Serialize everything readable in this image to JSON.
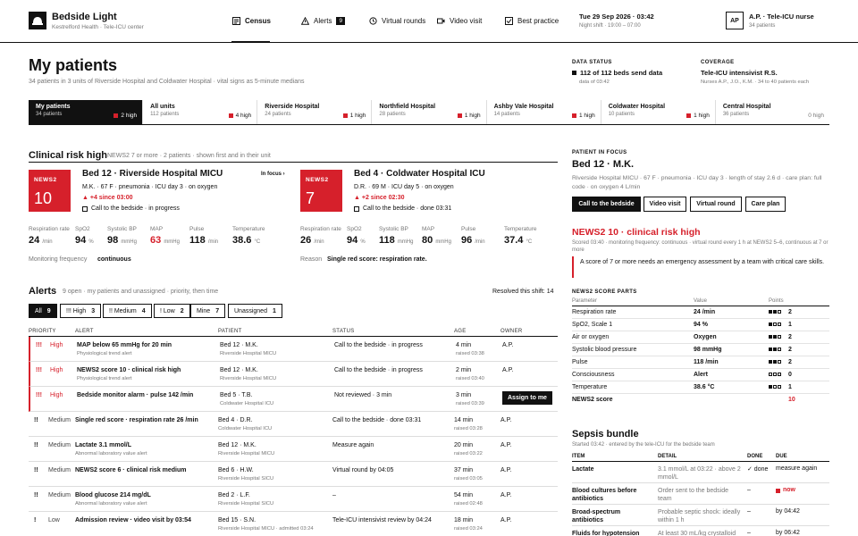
{
  "app": {
    "title": "Bedside Light",
    "subtitle": "Kestrelford Health · Tele-ICU center"
  },
  "nav": [
    {
      "label": "Census",
      "icon": "census-icon",
      "active": true
    },
    {
      "label": "Alerts",
      "icon": "alert-triangle-icon",
      "badge": "9"
    },
    {
      "label": "Virtual rounds",
      "icon": "rounds-icon"
    },
    {
      "label": "Video visit",
      "icon": "video-icon"
    },
    {
      "label": "Best practice",
      "icon": "checklist-icon"
    }
  ],
  "clock": {
    "date": "Tue 29 Sep 2026 · 03:42",
    "shift": "Night shift · 19:00 – 07:00"
  },
  "user": {
    "initials": "AP",
    "name": "A.P. · Tele-ICU nurse",
    "meta": "34 patients"
  },
  "page": {
    "title": "My patients",
    "subtitle": "34 patients in 3 units of Riverside Hospital and Coldwater Hospital · vital signs as 5-minute medians"
  },
  "status": {
    "data_label": "DATA STATUS",
    "data_value": "112 of 112 beds send data",
    "data_sub": "data of 03:42",
    "coverage_label": "COVERAGE",
    "coverage_value": "Tele-ICU intensivist R.S.",
    "coverage_sub": "Nurses A.P., J.O., K.M. · 34 to 40 patients each"
  },
  "units": [
    {
      "name": "My patients",
      "count": "34 patients",
      "high": "2 high",
      "active": true
    },
    {
      "name": "All units",
      "count": "112 patients",
      "high": "4 high"
    },
    {
      "name": "Riverside Hospital",
      "count": "24 patients",
      "high": "1 high"
    },
    {
      "name": "Northfield Hospital",
      "count": "28 patients",
      "high": "1 high"
    },
    {
      "name": "Ashby Vale Hospital",
      "count": "14 patients",
      "high": "1 high"
    },
    {
      "name": "Coldwater Hospital",
      "count": "10 patients",
      "high": "1 high"
    },
    {
      "name": "Central Hospital",
      "count": "36 patients",
      "high": "0 high"
    }
  ],
  "risk": {
    "title": "Clinical risk high",
    "sub": "NEWS2 7 or more · 2 patients · shown first and in their unit",
    "cards": [
      {
        "news_label": "NEWS2",
        "news": "10",
        "bed": "Bed 12 · Riverside Hospital MICU",
        "focus": "In focus ›",
        "line1": "M.K. · 67 F · pneumonia · ICU day 3 · on oxygen",
        "delta": "▲ +4 since 03:00",
        "check": "Call to the bedside · in progress",
        "vitals": [
          {
            "label": "Respiration rate",
            "value": "24",
            "unit": "/min"
          },
          {
            "label": "SpO2",
            "value": "94",
            "unit": "%"
          },
          {
            "label": "Systolic BP",
            "value": "98",
            "unit": "mmHg"
          },
          {
            "label": "MAP",
            "value": "63",
            "unit": "mmHg",
            "alarm": true
          },
          {
            "label": "Pulse",
            "value": "118",
            "unit": "/min"
          },
          {
            "label": "Temperature",
            "value": "38.6",
            "unit": "°C"
          }
        ],
        "foot_label": "Monitoring frequency",
        "foot_value": "continuous"
      },
      {
        "news_label": "NEWS2",
        "news": "7",
        "bed": "Bed 4 · Coldwater Hospital ICU",
        "line1": "D.R. · 69 M · ICU day 5 · on oxygen",
        "delta": "▲ +2 since 02:30",
        "check": "Call to the bedside · done 03:31",
        "vitals": [
          {
            "label": "Respiration rate",
            "value": "26",
            "unit": "/min"
          },
          {
            "label": "SpO2",
            "value": "94",
            "unit": "%"
          },
          {
            "label": "Systolic BP",
            "value": "118",
            "unit": "mmHg"
          },
          {
            "label": "MAP",
            "value": "80",
            "unit": "mmHg"
          },
          {
            "label": "Pulse",
            "value": "96",
            "unit": "/min"
          },
          {
            "label": "Temperature",
            "value": "37.4",
            "unit": "°C"
          }
        ],
        "foot_label": "Reason",
        "foot_value": "Single red score: respiration rate."
      }
    ]
  },
  "alerts": {
    "title": "Alerts",
    "sub": "9 open · my patients and unassigned · priority, then time",
    "resolved": "Resolved this shift: 14",
    "chips": [
      {
        "label": "All",
        "count": "9",
        "on": true
      },
      {
        "label": "!!! High",
        "count": "3"
      },
      {
        "label": "!! Medium",
        "count": "4"
      },
      {
        "label": "! Low",
        "count": "2"
      },
      {
        "label": "Mine",
        "count": "7"
      },
      {
        "label": "Unassigned",
        "count": "1"
      }
    ],
    "columns": [
      "PRIORITY",
      "ALERT",
      "PATIENT",
      "STATUS",
      "AGE",
      "OWNER"
    ],
    "rows": [
      {
        "pri": "!!!",
        "level": "High",
        "alert": "MAP below 65 mmHg for 20 min",
        "kind": "Physiological trend alert",
        "bed": "Bed 12 · M.K.",
        "unit": "Riverside Hospital MICU",
        "status": "Call to the bedside · in progress",
        "age": "4 min",
        "raised": "raised 03:38",
        "owner": "A.P."
      },
      {
        "pri": "!!!",
        "level": "High",
        "alert": "NEWS2 score 10 · clinical risk high",
        "kind": "Physiological trend alert",
        "bed": "Bed 12 · M.K.",
        "unit": "Riverside Hospital MICU",
        "status": "Call to the bedside · in progress",
        "age": "2 min",
        "raised": "raised 03:40",
        "owner": "A.P."
      },
      {
        "pri": "!!!",
        "level": "High",
        "alert": "Bedside monitor alarm · pulse 142 /min",
        "kind": "",
        "bed": "Bed 5 · T.B.",
        "unit": "Coldwater Hospital ICU",
        "status": "Not reviewed · 3 min",
        "age": "3 min",
        "raised": "raised 03:39",
        "owner": "",
        "action": "Assign to me"
      },
      {
        "pri": "!!",
        "level": "Medium",
        "alert": "Single red score · respiration rate 26 /min",
        "kind": "",
        "bed": "Bed 4 · D.R.",
        "unit": "Coldwater Hospital ICU",
        "status": "Call to the bedside · done 03:31",
        "age": "14 min",
        "raised": "raised 03:28",
        "owner": "A.P."
      },
      {
        "pri": "!!",
        "level": "Medium",
        "alert": "Lactate 3.1 mmol/L",
        "kind": "Abnormal laboratory value alert",
        "bed": "Bed 12 · M.K.",
        "unit": "Riverside Hospital MICU",
        "status": "Measure again",
        "age": "20 min",
        "raised": "raised 03:22",
        "owner": "A.P."
      },
      {
        "pri": "!!",
        "level": "Medium",
        "alert": "NEWS2 score 6 · clinical risk medium",
        "kind": "",
        "bed": "Bed 6 · H.W.",
        "unit": "Riverside Hospital SICU",
        "status": "Virtual round by 04:05",
        "age": "37 min",
        "raised": "raised 03:05",
        "owner": "A.P."
      },
      {
        "pri": "!!",
        "level": "Medium",
        "alert": "Blood glucose 214 mg/dL",
        "kind": "Abnormal laboratory value alert",
        "bed": "Bed 2 · L.F.",
        "unit": "Riverside Hospital SICU",
        "status": "–",
        "age": "54 min",
        "raised": "raised 02:48",
        "owner": "A.P."
      },
      {
        "pri": "!",
        "level": "Low",
        "alert": "Admission review · video visit by 03:54",
        "kind": "",
        "bed": "Bed 15 · S.N.",
        "unit": "Riverside Hospital MICU · admitted 03:24",
        "status": "Tele-ICU intensivist review by 04:24",
        "age": "18 min",
        "raised": "raised 03:24",
        "owner": "A.P."
      }
    ]
  },
  "focus": {
    "label": "PATIENT IN FOCUS",
    "name": "Bed 12 · M.K.",
    "desc": "Riverside Hospital MICU · 67 F · pneumonia · ICU day 3 · length of stay 2.6 d · care plan: full code · on oxygen 4 L/min",
    "buttons": [
      "Call to the bedside",
      "Video visit",
      "Virtual round",
      "Care plan"
    ],
    "alert_title": "NEWS2 10 · clinical risk high",
    "alert_sub": "Scored 03:40 · monitoring frequency: continuous · virtual round every 1 h at NEWS2 5–6, continuous at 7 or more",
    "alert_note": "A score of 7 or more needs an emergency assessment by a team with critical care skills.",
    "parts_title": "NEWS2 SCORE PARTS",
    "parts_cols": [
      "Parameter",
      "Value",
      "Points"
    ],
    "parts": [
      {
        "p": "Respiration rate",
        "v": "24 /min",
        "pts": "2",
        "n": 2
      },
      {
        "p": "SpO2, Scale 1",
        "v": "94 %",
        "pts": "1",
        "n": 1
      },
      {
        "p": "Air or oxygen",
        "v": "Oxygen",
        "pts": "2",
        "n": 2
      },
      {
        "p": "Systolic blood pressure",
        "v": "98 mmHg",
        "pts": "2",
        "n": 2
      },
      {
        "p": "Pulse",
        "v": "118 /min",
        "pts": "2",
        "n": 2
      },
      {
        "p": "Consciousness",
        "v": "Alert",
        "pts": "0",
        "n": 0
      },
      {
        "p": "Temperature",
        "v": "38.6 °C",
        "pts": "1",
        "n": 1
      }
    ],
    "total_label": "NEWS2 score",
    "total": "10",
    "bundle_title": "Sepsis bundle",
    "bundle_sub": "Started 03:42 · entered by the tele-ICU for the bedside team",
    "bundle_cols": [
      "ITEM",
      "DETAIL",
      "DONE",
      "DUE"
    ],
    "bundle": [
      {
        "item": "Lactate",
        "detail": "3.1 mmol/L at 03:22 · above 2 mmol/L",
        "done": "✓ done",
        "due": "measure again"
      },
      {
        "item": "Blood cultures before antibiotics",
        "detail": "Order sent to the bedside team",
        "done": "–",
        "due": "now"
      },
      {
        "item": "Broad-spectrum antibiotics",
        "detail": "Probable septic shock: ideally within 1 h",
        "done": "–",
        "due": "by 04:42"
      },
      {
        "item": "Fluids for hypotension",
        "detail": "At least 30 mL/kg crystalloid",
        "done": "–",
        "due": "by 06:42"
      }
    ]
  }
}
